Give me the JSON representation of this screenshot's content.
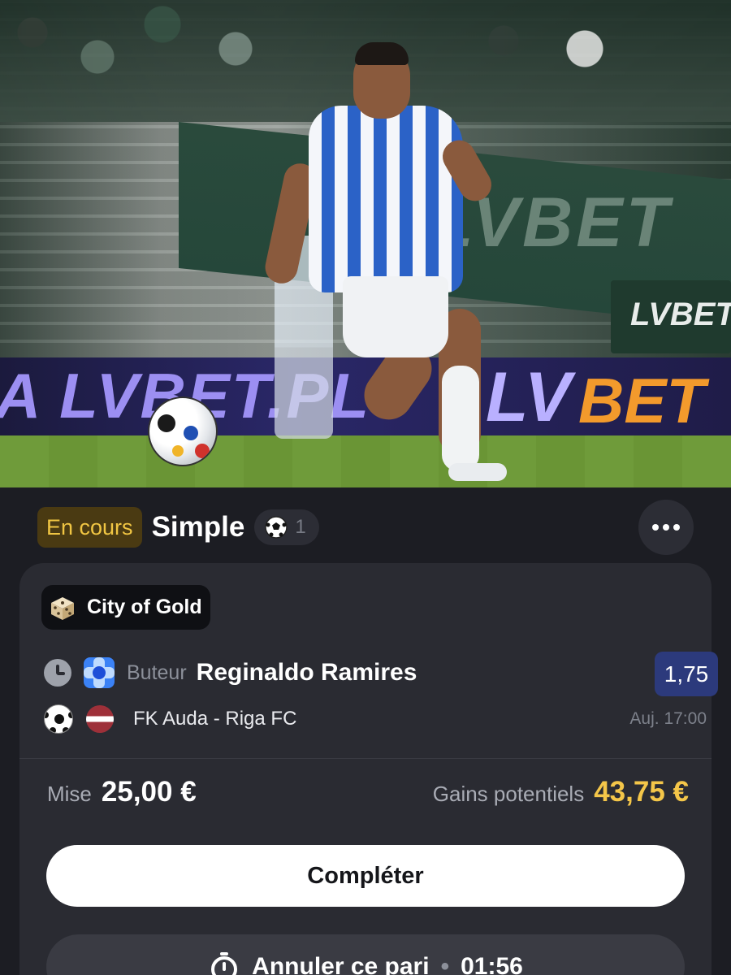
{
  "hero": {
    "roof_text": "LVBET",
    "side_board_text": "LVBET",
    "ad_left_text": "A LVBET.PL",
    "ad_right_lv": "LV",
    "ad_right_bet": "BET",
    "bet_color": "#f39a2c"
  },
  "bet": {
    "status": "En cours",
    "type": "Simple",
    "selection_count": "1",
    "more_icon": "more-dots-icon",
    "casino_tag": "City of Gold",
    "market": "Buteur",
    "player": "Reginaldo Ramires",
    "odds": "1,75",
    "match": "FK Auda - Riga FC",
    "time": "Auj. 17:00",
    "stake_label": "Mise",
    "stake_value": "25,00 €",
    "gain_label": "Gains potentiels",
    "gain_value": "43,75 €",
    "complete_label": "Compléter",
    "cancel_label": "Annuler ce pari",
    "cancel_timer": "01:56"
  },
  "colors": {
    "status_text": "#f0c543",
    "status_bg": "#4a3a12",
    "odds_bg": "#2c3a7c",
    "gain": "#f4c649"
  }
}
